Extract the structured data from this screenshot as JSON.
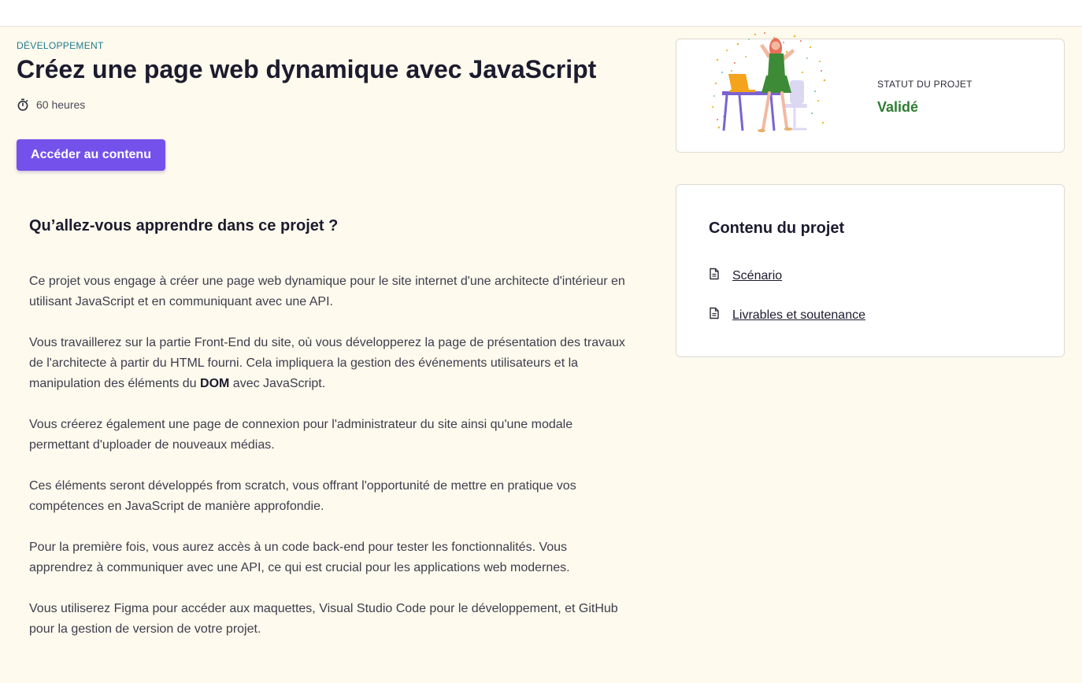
{
  "header": {
    "category": "DÉVELOPPEMENT",
    "title": "Créez une page web dynamique avec JavaScript",
    "duration": "60 heures"
  },
  "actions": {
    "access_label": "Accéder au contenu"
  },
  "learn": {
    "heading": "Qu’allez-vous apprendre dans ce projet ?",
    "p1": "Ce projet vous engage à créer une page web dynamique pour le site internet d'une architecte d'intérieur en utilisant JavaScript et en communiquant avec une API.",
    "p2_before": "Vous travaillerez sur la partie Front-End du site, où vous développerez la page de présentation des travaux de l'architecte à partir du HTML fourni. Cela impliquera la gestion des événements utilisateurs et la manipulation des éléments du ",
    "p2_bold": "DOM",
    "p2_after": " avec JavaScript.",
    "p3": "Vous créerez également une page de connexion pour l'administrateur du site ainsi qu'une modale permettant d'uploader de nouveaux médias.",
    "p4": "Ces éléments seront développés from scratch, vous offrant l'opportunité de mettre en pratique vos compétences en JavaScript de manière approfondie.",
    "p5": "Pour la première fois, vous aurez accès à un code back-end pour tester les fonctionnalités. Vous apprendrez à communiquer avec une API, ce qui est crucial pour les applications web modernes.",
    "p6": "Vous utiliserez Figma pour accéder aux maquettes, Visual Studio Code pour le développement, et GitHub pour la gestion de version de votre projet."
  },
  "status": {
    "label": "STATUT DU PROJET",
    "value": "Validé",
    "value_color": "#2e7d32"
  },
  "content": {
    "heading": "Contenu du projet",
    "items": [
      {
        "label": "Scénario",
        "icon": "document-icon"
      },
      {
        "label": "Livrables et soutenance",
        "icon": "document-icon"
      }
    ]
  },
  "colors": {
    "accent": "#7451eb",
    "background": "#fefaed",
    "category": "#1f7a8c"
  }
}
